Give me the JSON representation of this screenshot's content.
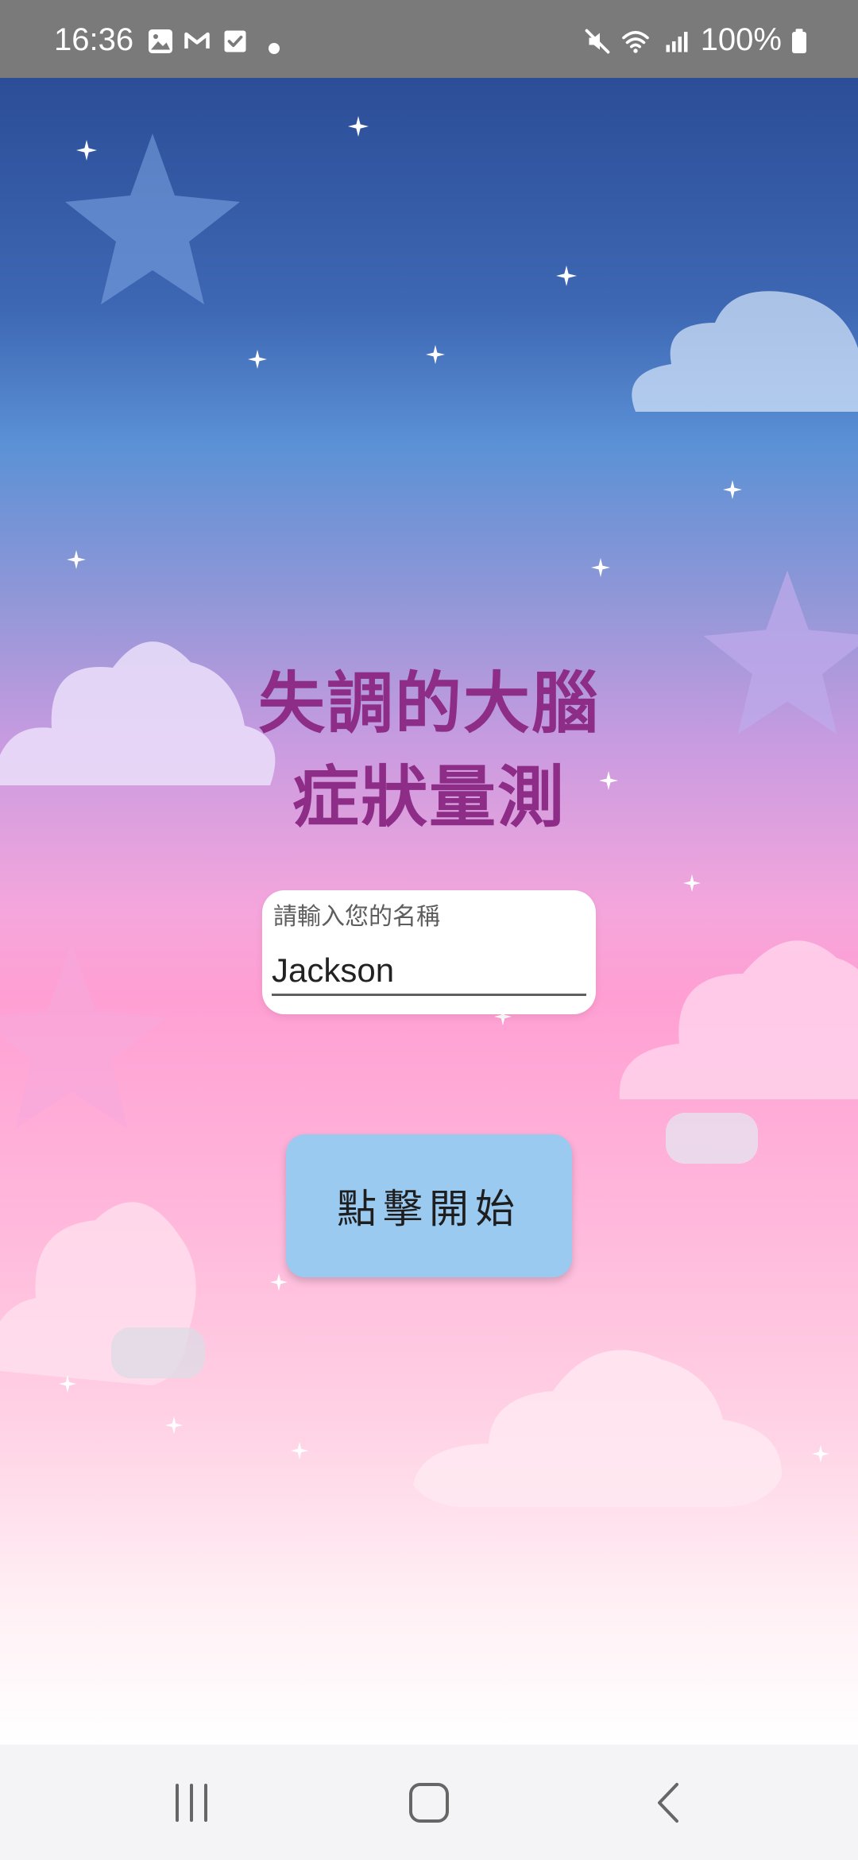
{
  "status_bar": {
    "time": "16:36",
    "battery": "100%",
    "icons": [
      "image-icon",
      "gmail-icon",
      "check-icon",
      "mute-icon",
      "wifi-icon",
      "signal-icon",
      "battery-icon"
    ]
  },
  "title": {
    "line1": "失調的大腦",
    "line2": "症狀量測"
  },
  "name_field": {
    "label": "請輸入您的名稱",
    "value": "Jackson"
  },
  "start_button": {
    "label": "點擊開始"
  },
  "colors": {
    "title": "#8e2d87",
    "button": "#9bcaf1",
    "status_bar": "#7a7a7a"
  },
  "nav": {
    "icons": [
      "recents-icon",
      "home-icon",
      "back-icon"
    ]
  }
}
